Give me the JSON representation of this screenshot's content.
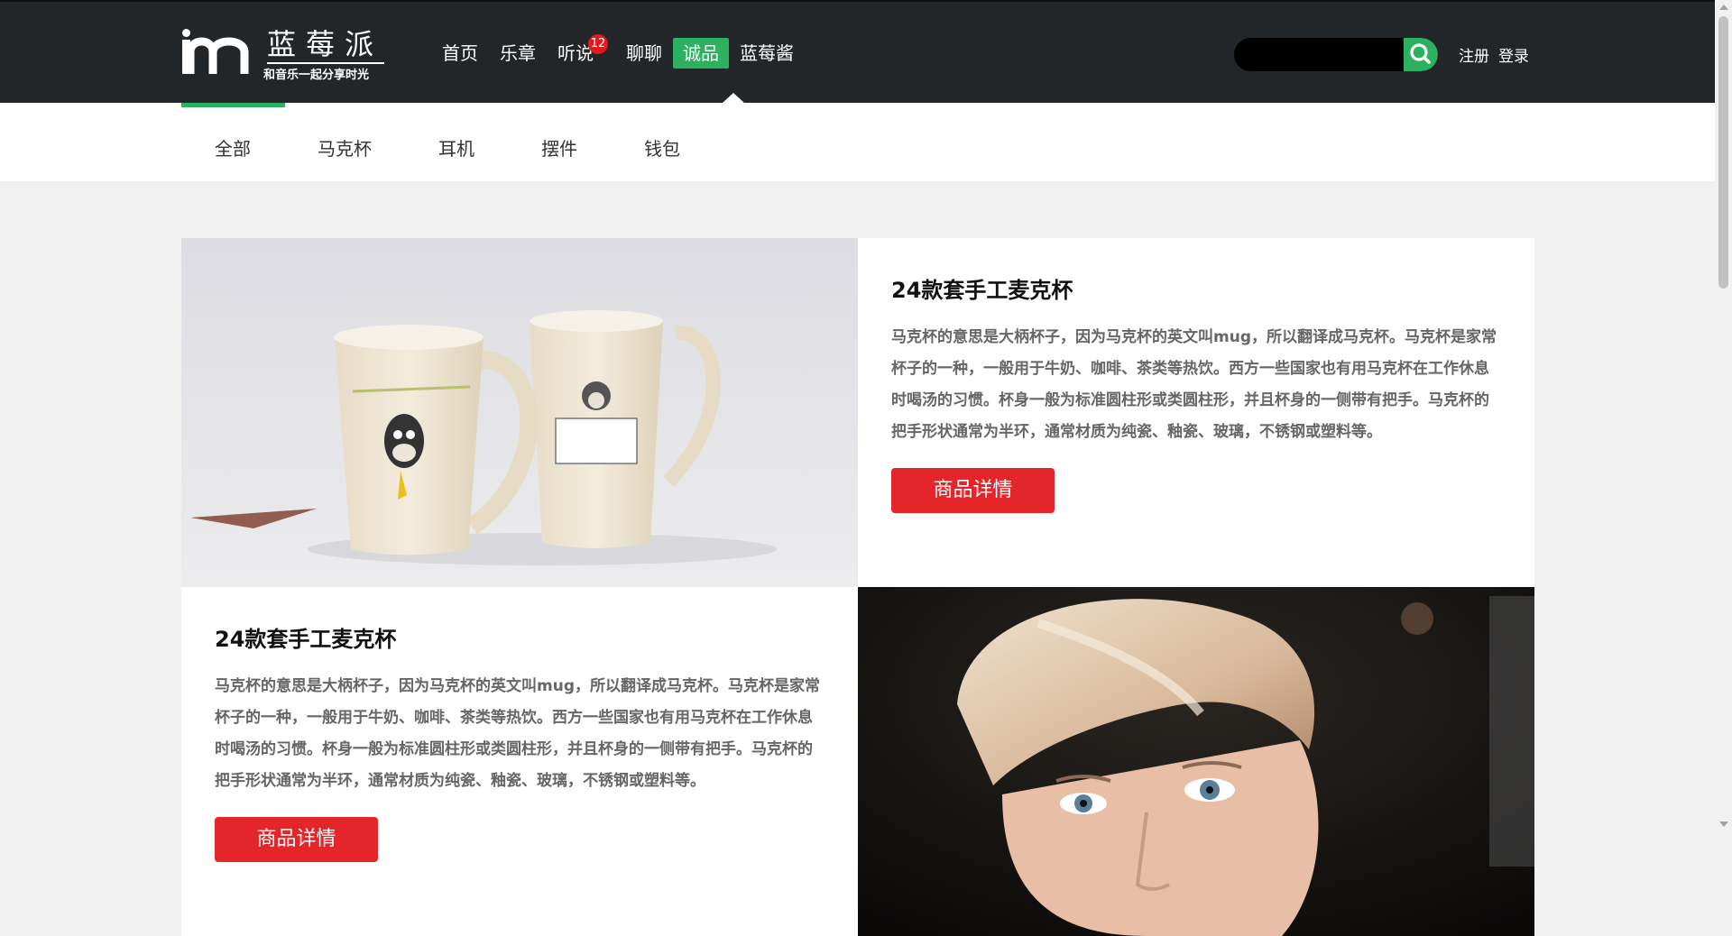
{
  "brand": {
    "name": "蓝莓派",
    "slogan": "和音乐一起分享时光"
  },
  "nav": {
    "items": [
      {
        "label": "首页"
      },
      {
        "label": "乐章"
      },
      {
        "label": "听说",
        "badge": "12"
      },
      {
        "label": "聊聊"
      },
      {
        "label": "诚品",
        "active": true
      },
      {
        "label": "蓝莓酱"
      }
    ]
  },
  "search": {
    "value": "",
    "placeholder": ""
  },
  "auth": {
    "register": "注册",
    "login": "登录"
  },
  "categories": {
    "active_index": 0,
    "items": [
      "全部",
      "马克杯",
      "耳机",
      "摆件",
      "钱包"
    ]
  },
  "products": [
    {
      "title": "24款套手工麦克杯",
      "description": "马克杯的意思是大柄杯子，因为马克杯的英文叫mug，所以翻译成马克杯。马克杯是家常杯子的一种，一般用于牛奶、咖啡、茶类等热饮。西方一些国家也有用马克杯在工作休息时喝汤的习惯。杯身一般为标准圆柱形或类圆柱形，并且杯身的一侧带有把手。马克杯的把手形状通常为半环，通常材质为纯瓷、釉瓷、玻璃，不锈钢或塑料等。",
      "button": "商品详情",
      "image": "mug-photo"
    },
    {
      "title": "24款套手工麦克杯",
      "description": "马克杯的意思是大柄杯子，因为马克杯的英文叫mug，所以翻译成马克杯。马克杯是家常杯子的一种，一般用于牛奶、咖啡、茶类等热饮。西方一些国家也有用马克杯在工作休息时喝汤的习惯。杯身一般为标准圆柱形或类圆柱形，并且杯身的一侧带有把手。马克杯的把手形状通常为半环，通常材质为纯瓷、釉瓷、玻璃，不锈钢或塑料等。",
      "button": "商品详情",
      "image": "portrait-photo"
    }
  ],
  "colors": {
    "topbar": "#232628",
    "accent_green": "#2bb15f",
    "button_red": "#e4262b",
    "badge_red": "#e31a1c",
    "page_bg": "#f0f0f0"
  }
}
